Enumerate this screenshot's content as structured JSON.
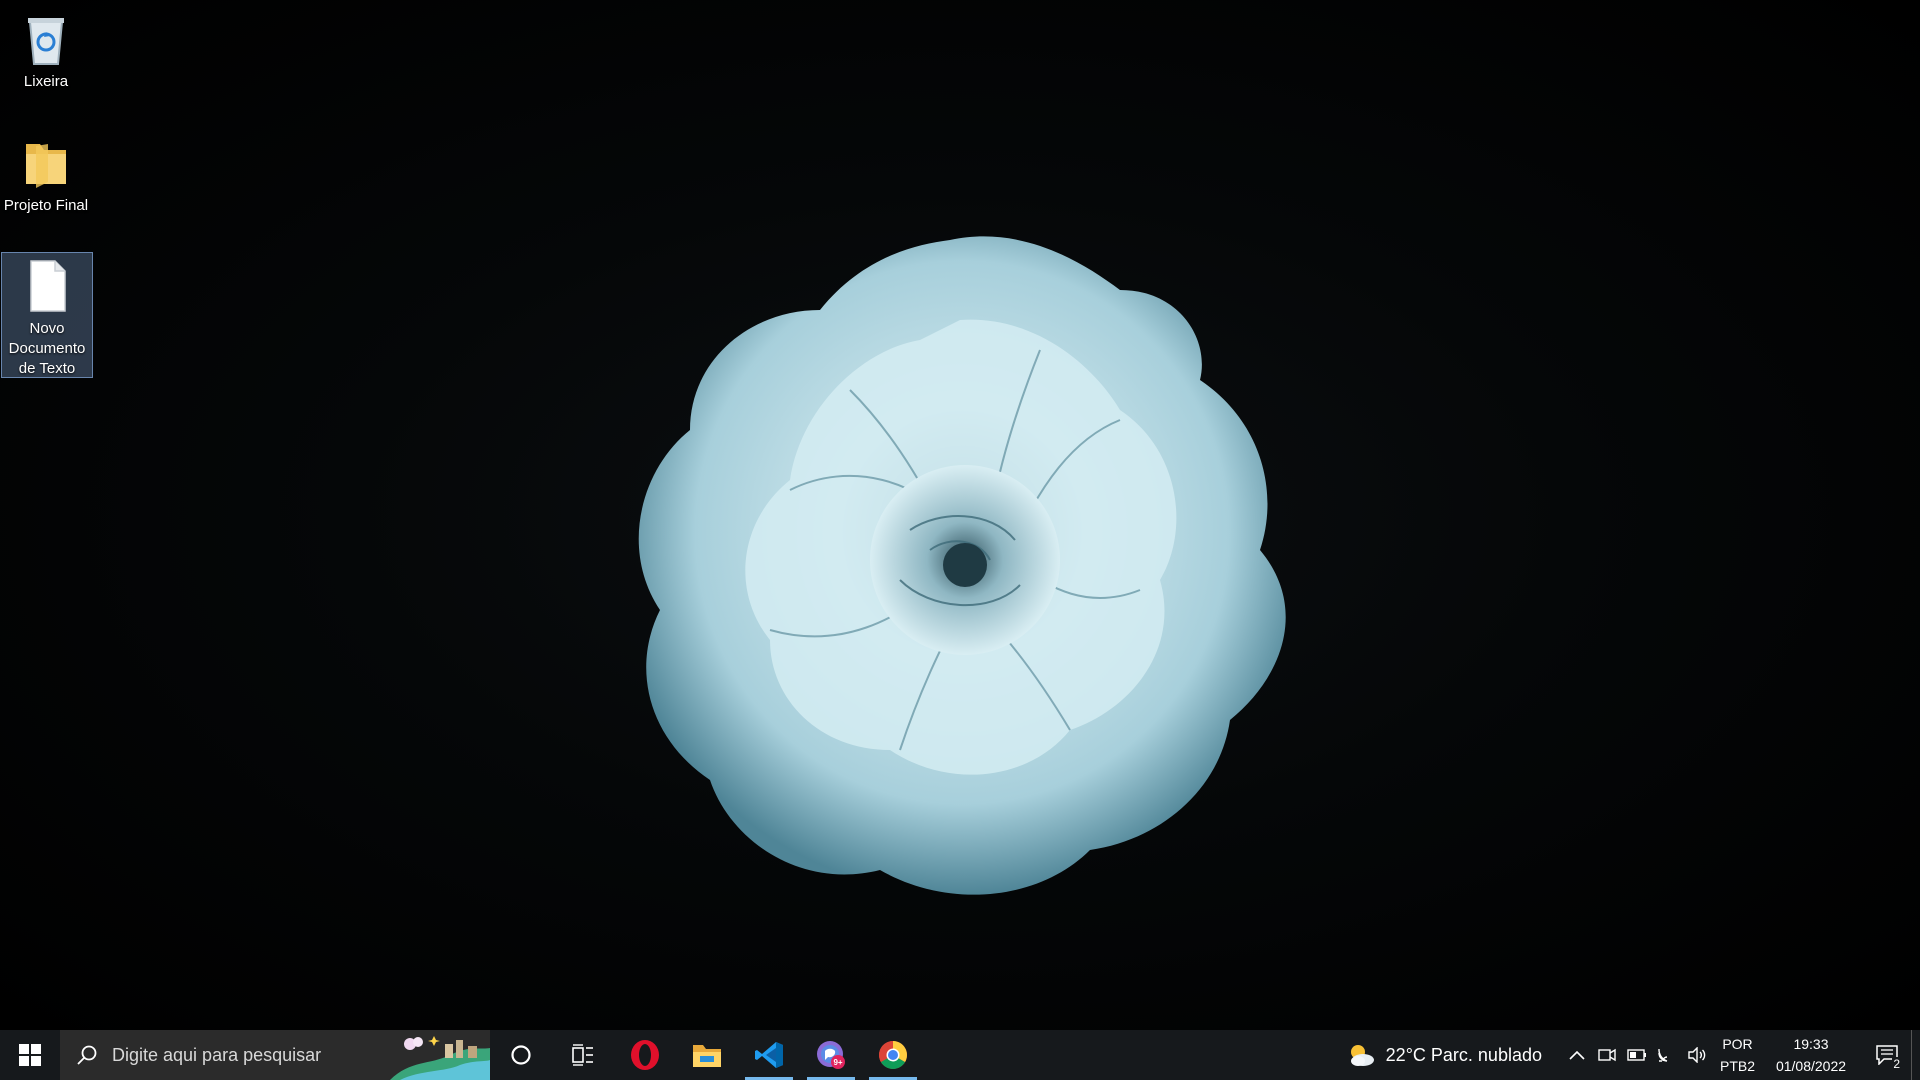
{
  "desktop": {
    "icons": [
      {
        "label": "Lixeira",
        "icon": "recycle-bin-icon"
      },
      {
        "label": "Projeto Final",
        "icon": "folder-icon"
      },
      {
        "label": "Novo Documento de Texto",
        "icon": "text-document-icon",
        "selected": true
      }
    ],
    "wallpaper": "blue-rose-on-black"
  },
  "taskbar": {
    "search_placeholder": "Digite aqui para pesquisar",
    "apps": [
      {
        "name": "cortana-icon"
      },
      {
        "name": "task-view-icon"
      },
      {
        "name": "opera-icon"
      },
      {
        "name": "file-explorer-icon"
      },
      {
        "name": "vscode-icon",
        "active": true
      },
      {
        "name": "chat-app-icon",
        "badge": "9+",
        "active": true
      },
      {
        "name": "chrome-icon",
        "active": true
      }
    ],
    "weather": {
      "temp": "22°C",
      "condition": "Parc. nublado"
    },
    "language": {
      "line1": "POR",
      "line2": "PTB2"
    },
    "clock": {
      "time": "19:33",
      "date": "01/08/2022"
    },
    "notifications_count": "2"
  },
  "colors": {
    "taskbar_bg": "#16191c",
    "accent": "#76b9ed",
    "flower": "#a9d3df"
  }
}
